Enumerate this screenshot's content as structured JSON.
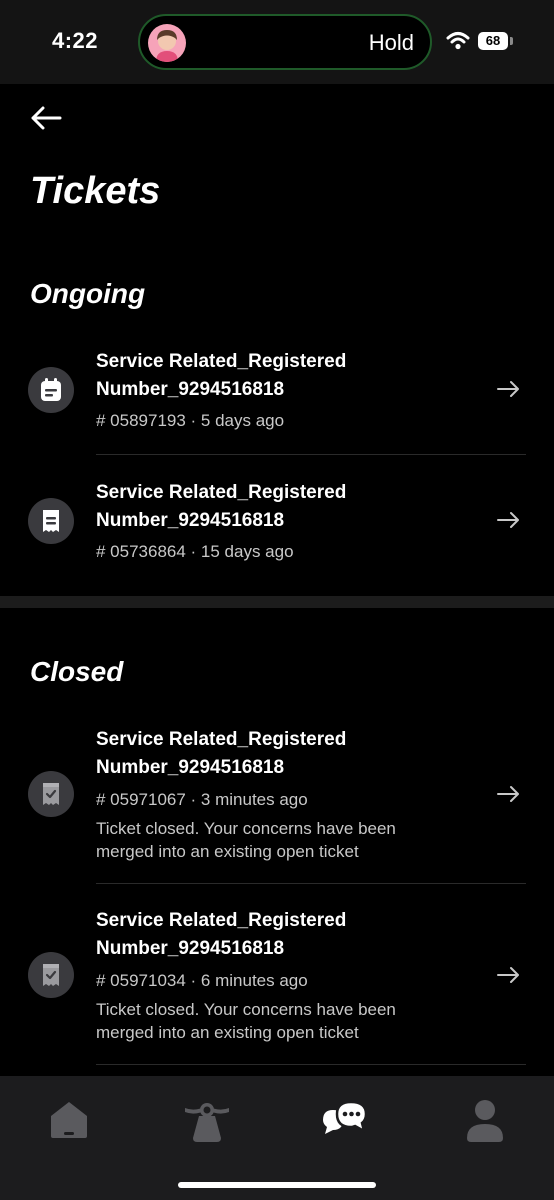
{
  "status_bar": {
    "time": "4:22",
    "call_status": "Hold",
    "battery": "68"
  },
  "header": {
    "title": "Tickets"
  },
  "sections": {
    "ongoing": {
      "title": "Ongoing",
      "tickets": [
        {
          "title": "Service Related_Registered Number_9294516818",
          "meta": "# 05897193 · 5 days ago",
          "icon": "calendar-icon"
        },
        {
          "title": "Service Related_Registered Number_9294516818",
          "meta": "# 05736864 · 15 days ago",
          "icon": "receipt-icon"
        }
      ]
    },
    "closed": {
      "title": "Closed",
      "tickets": [
        {
          "title": "Service Related_Registered Number_9294516818",
          "meta": "# 05971067 · 3 minutes ago",
          "note": "Ticket closed. Your concerns have been merged into an existing open ticket",
          "icon": "receipt-check-icon"
        },
        {
          "title": "Service Related_Registered Number_9294516818",
          "meta": "# 05971034 · 6 minutes ago",
          "note": "Ticket closed. Your concerns have been merged into an existing open ticket",
          "icon": "receipt-check-icon"
        }
      ]
    }
  },
  "bottom_nav": {
    "items": [
      {
        "icon": "home-icon",
        "active": false
      },
      {
        "icon": "scooter-icon",
        "active": false
      },
      {
        "icon": "chat-icon",
        "active": true
      },
      {
        "icon": "profile-icon",
        "active": false
      }
    ]
  },
  "colors": {
    "background": "#000000",
    "card_icon_bg": "#3a3a3e",
    "muted_text": "#c8c8c8",
    "nav_bg": "#1c1c1e",
    "nav_inactive": "#5a5a5e",
    "call_border": "#1f5a29"
  }
}
